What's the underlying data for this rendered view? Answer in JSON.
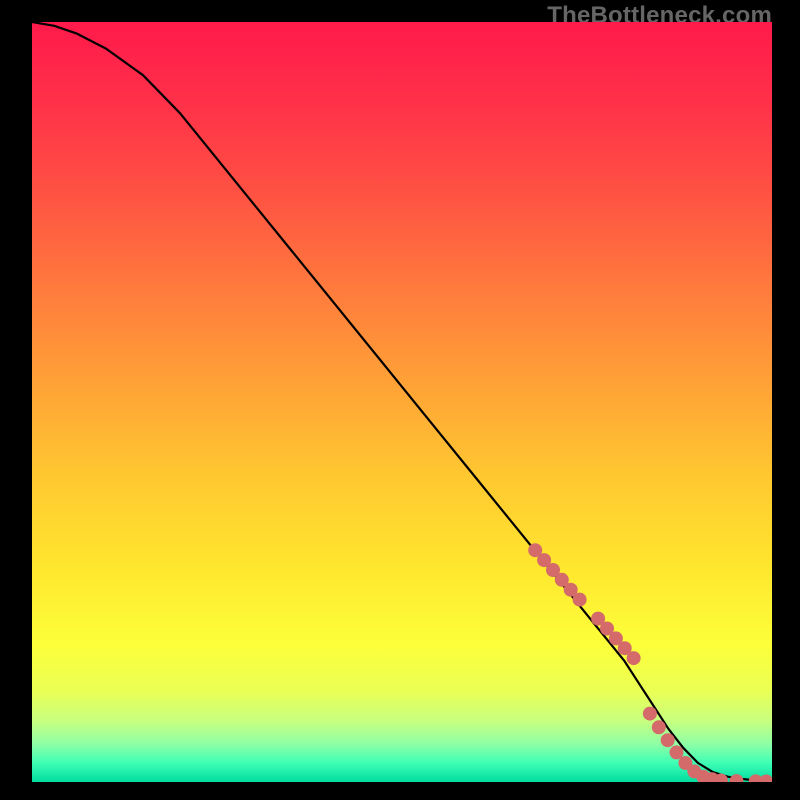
{
  "watermark": "TheBottleneck.com",
  "chart_data": {
    "type": "line",
    "title": "",
    "xlabel": "",
    "ylabel": "",
    "xlim": [
      0,
      100
    ],
    "ylim": [
      0,
      100
    ],
    "curve": {
      "name": "bottleneck-curve",
      "x": [
        0,
        3,
        6,
        10,
        15,
        20,
        25,
        30,
        35,
        40,
        45,
        50,
        55,
        60,
        65,
        70,
        75,
        80,
        82,
        84,
        86,
        88,
        90,
        92,
        94,
        96,
        98,
        100
      ],
      "y": [
        100,
        99.5,
        98.5,
        96.5,
        93,
        88,
        82,
        76,
        70,
        64,
        58,
        52,
        46,
        40,
        34,
        28,
        22,
        16,
        13,
        10,
        7,
        4.5,
        2.5,
        1.3,
        0.7,
        0.4,
        0.2,
        0.1
      ]
    },
    "markers": {
      "name": "highlight-points",
      "color": "#d46a6a",
      "radius": 7,
      "points": [
        {
          "x": 68.0,
          "y": 30.5
        },
        {
          "x": 69.2,
          "y": 29.2
        },
        {
          "x": 70.4,
          "y": 27.9
        },
        {
          "x": 71.6,
          "y": 26.6
        },
        {
          "x": 72.8,
          "y": 25.3
        },
        {
          "x": 74.0,
          "y": 24.0
        },
        {
          "x": 76.5,
          "y": 21.5
        },
        {
          "x": 77.7,
          "y": 20.2
        },
        {
          "x": 78.9,
          "y": 18.9
        },
        {
          "x": 80.1,
          "y": 17.6
        },
        {
          "x": 81.3,
          "y": 16.3
        },
        {
          "x": 83.5,
          "y": 9.0
        },
        {
          "x": 84.7,
          "y": 7.2
        },
        {
          "x": 85.9,
          "y": 5.5
        },
        {
          "x": 87.1,
          "y": 3.9
        },
        {
          "x": 88.3,
          "y": 2.5
        },
        {
          "x": 89.5,
          "y": 1.4
        },
        {
          "x": 90.7,
          "y": 0.7
        },
        {
          "x": 91.9,
          "y": 0.35
        },
        {
          "x": 93.1,
          "y": 0.2
        },
        {
          "x": 95.2,
          "y": 0.12
        },
        {
          "x": 97.8,
          "y": 0.08
        },
        {
          "x": 99.2,
          "y": 0.06
        }
      ]
    },
    "gradient_stops": [
      {
        "offset": 0.0,
        "color": "#ff1a4b"
      },
      {
        "offset": 0.1,
        "color": "#ff2f49"
      },
      {
        "offset": 0.22,
        "color": "#ff5043"
      },
      {
        "offset": 0.35,
        "color": "#ff7a3d"
      },
      {
        "offset": 0.48,
        "color": "#ffa336"
      },
      {
        "offset": 0.6,
        "color": "#ffc830"
      },
      {
        "offset": 0.72,
        "color": "#ffe72e"
      },
      {
        "offset": 0.82,
        "color": "#fcff3a"
      },
      {
        "offset": 0.88,
        "color": "#eaff54"
      },
      {
        "offset": 0.92,
        "color": "#c7ff80"
      },
      {
        "offset": 0.95,
        "color": "#8effa5"
      },
      {
        "offset": 0.975,
        "color": "#3effb5"
      },
      {
        "offset": 1.0,
        "color": "#00dca0"
      }
    ]
  }
}
